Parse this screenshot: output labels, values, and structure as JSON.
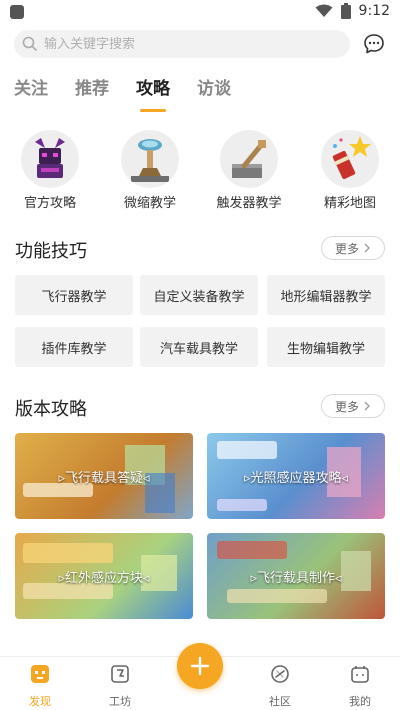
{
  "status_bar": {
    "time": "9:12"
  },
  "search": {
    "placeholder": "输入关键字搜索"
  },
  "tabs": [
    {
      "label": "关注",
      "active": false
    },
    {
      "label": "推荐",
      "active": false
    },
    {
      "label": "攻略",
      "active": true
    },
    {
      "label": "访谈",
      "active": false
    }
  ],
  "quick_links": [
    {
      "label": "官方攻略",
      "icon": "dragon-icon"
    },
    {
      "label": "微缩教学",
      "icon": "magnifier-stand-icon"
    },
    {
      "label": "触发器教学",
      "icon": "lever-icon"
    },
    {
      "label": "精彩地图",
      "icon": "star-firework-icon"
    }
  ],
  "skills_section": {
    "title": "功能技巧",
    "more_label": "更多",
    "items": [
      "飞行器教学",
      "自定义装备教学",
      "地形编辑器教学",
      "插件库教学",
      "汽车载具教学",
      "生物编辑教学"
    ]
  },
  "version_section": {
    "title": "版本攻略",
    "more_label": "更多",
    "cards": [
      {
        "label": "飞行载具答疑",
        "bg": "#d9a23e"
      },
      {
        "label": "光照感应器攻略",
        "bg": "#6fb6e0"
      },
      {
        "label": "红外感应方块",
        "bg": "#e2a046"
      },
      {
        "label": "飞行载具制作",
        "bg": "#7fa66a"
      }
    ]
  },
  "bottom_nav": {
    "items": [
      {
        "label": "发现",
        "active": true
      },
      {
        "label": "工坊",
        "active": false
      },
      {
        "label": "社区",
        "active": false
      },
      {
        "label": "我的",
        "active": false
      }
    ]
  },
  "colors": {
    "accent": "#f5a623",
    "chip_bg": "#f2f2f2",
    "text": "#222222",
    "muted": "#888888"
  }
}
